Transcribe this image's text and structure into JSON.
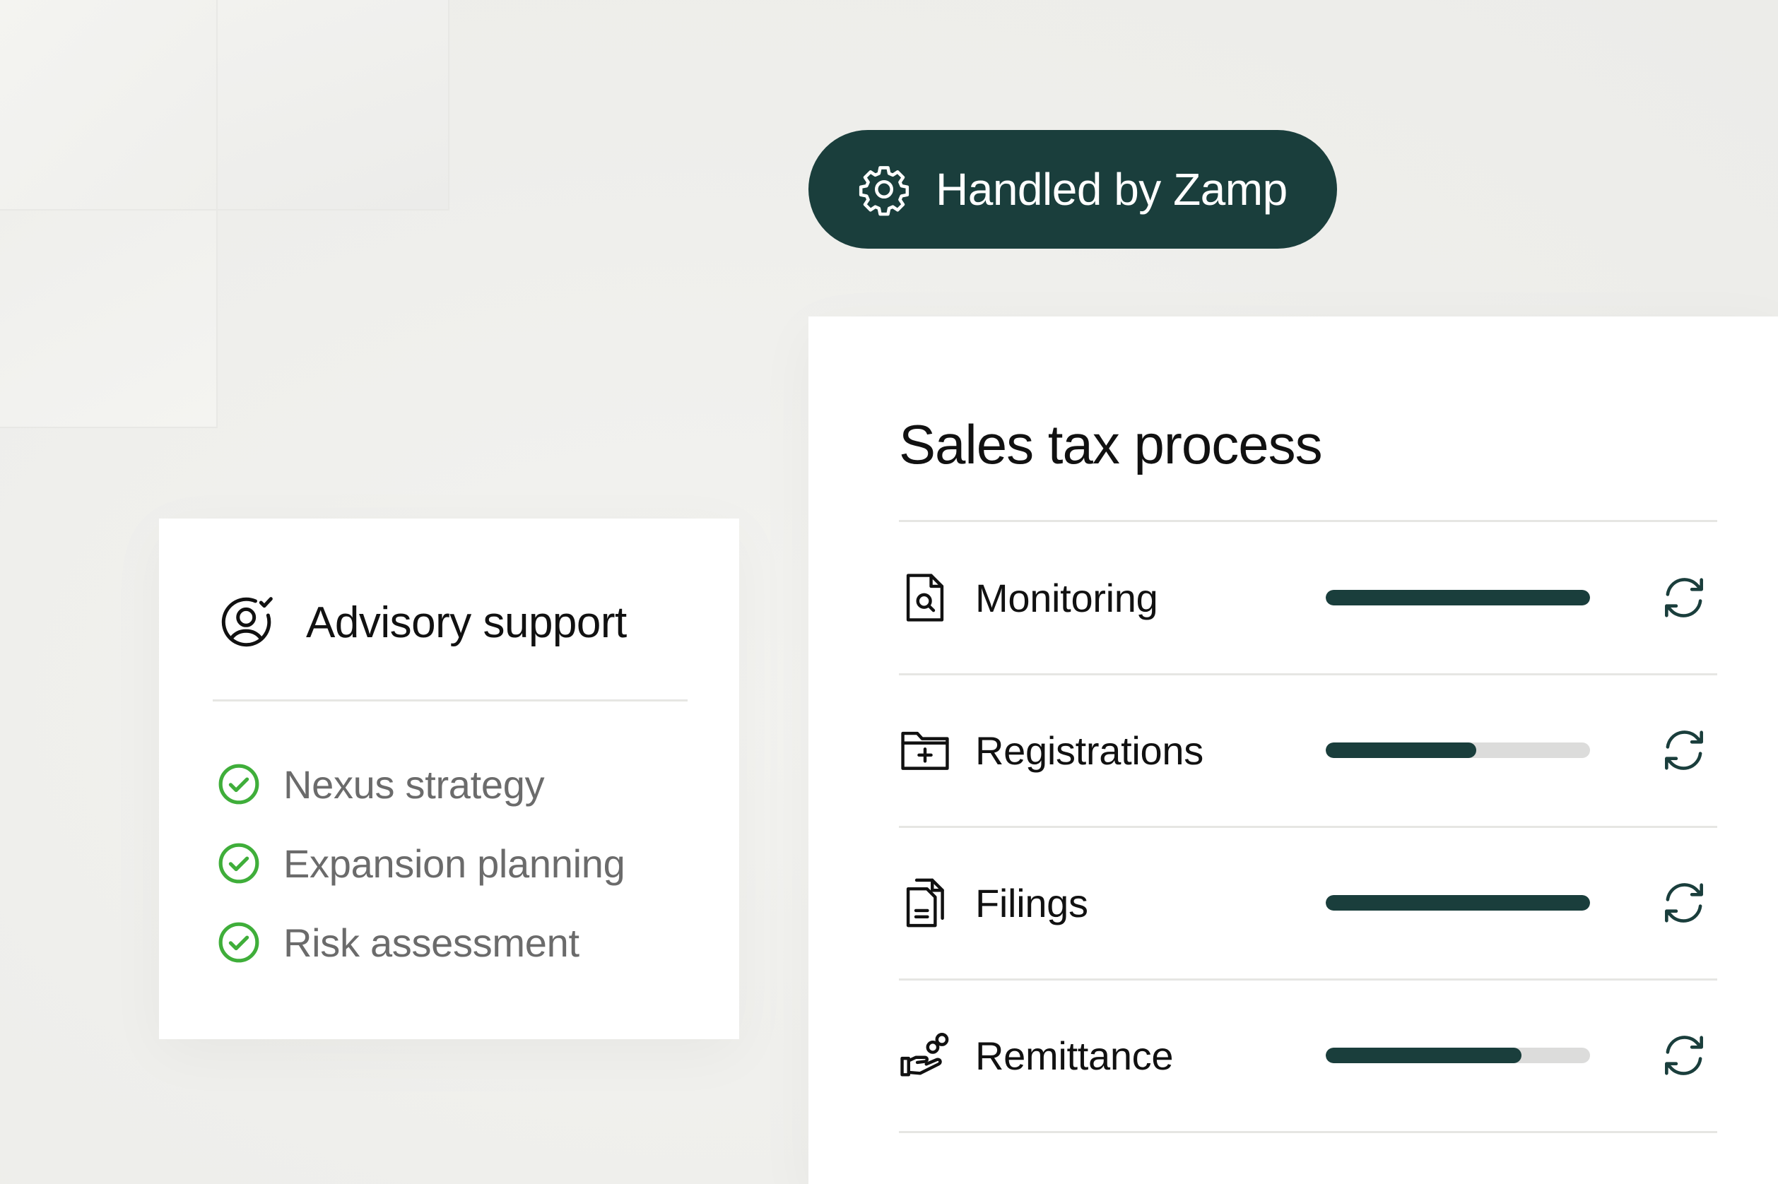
{
  "badge": {
    "label": "Handled by Zamp",
    "icon": "gear-icon"
  },
  "advisory": {
    "title": "Advisory support",
    "icon": "user-check-icon",
    "items": [
      {
        "label": "Nexus strategy",
        "icon": "check-circle-icon"
      },
      {
        "label": "Expansion planning",
        "icon": "check-circle-icon"
      },
      {
        "label": "Risk assessment",
        "icon": "check-circle-icon"
      }
    ]
  },
  "sales_tax": {
    "title": "Sales tax process",
    "rows": [
      {
        "label": "Monitoring",
        "icon": "document-search-icon",
        "progress": 1.0,
        "status_icon": "sync-icon"
      },
      {
        "label": "Registrations",
        "icon": "folder-plus-icon",
        "progress": 0.57,
        "status_icon": "sync-icon"
      },
      {
        "label": "Filings",
        "icon": "documents-icon",
        "progress": 1.0,
        "status_icon": "sync-icon"
      },
      {
        "label": "Remittance",
        "icon": "hand-coins-icon",
        "progress": 0.74,
        "status_icon": "sync-icon"
      }
    ]
  },
  "colors": {
    "brand_dark": "#1a3e3c",
    "check_green": "#3fae3a",
    "track_gray": "#dcdcdb"
  }
}
